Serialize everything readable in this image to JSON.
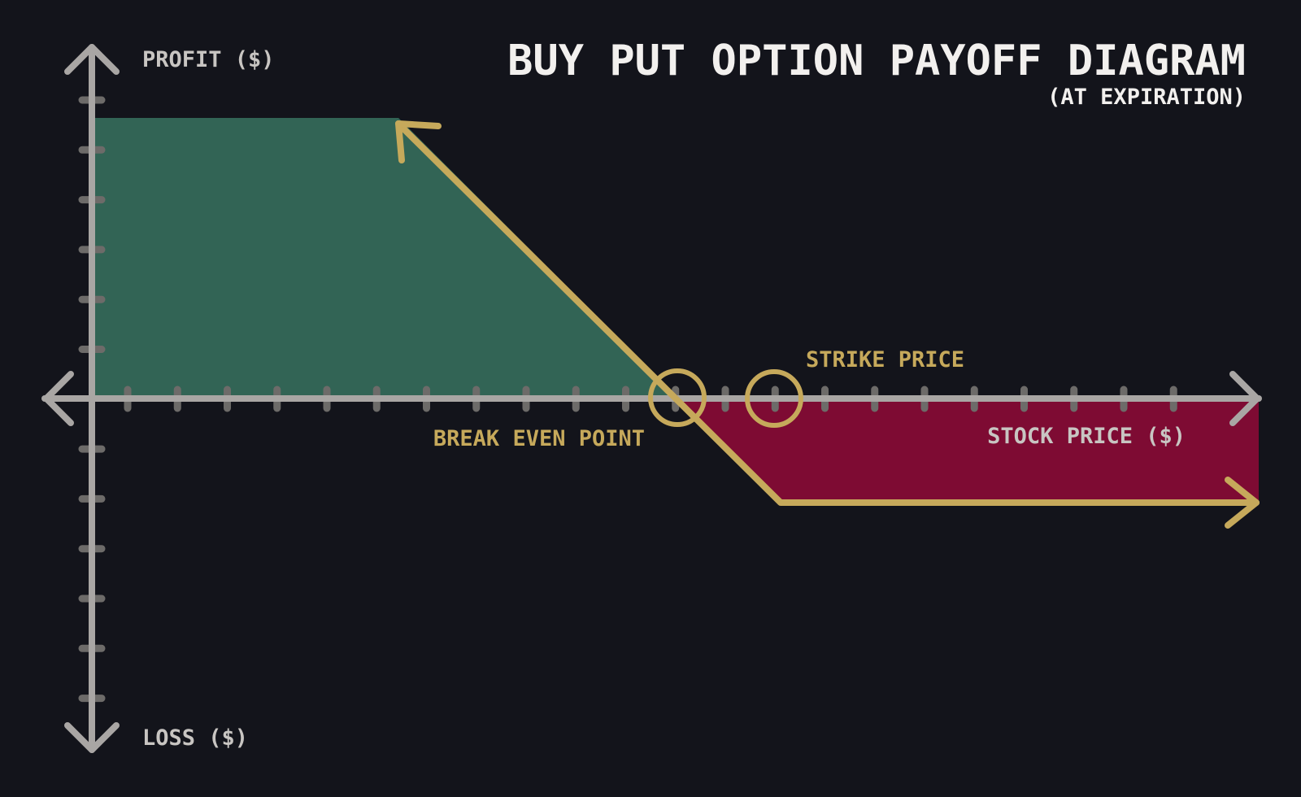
{
  "title": "BUY PUT OPTION PAYOFF DIAGRAM",
  "subtitle": "(AT EXPIRATION)",
  "axes": {
    "y_top_label": "PROFIT ($)",
    "y_bottom_label": "LOSS ($)",
    "x_label": "STOCK PRICE ($)"
  },
  "annotations": {
    "break_even": "BREAK EVEN POINT",
    "strike": "STRIKE PRICE"
  },
  "colors": {
    "background": "#13141b",
    "axis": "#a9a6a4",
    "tick": "#6d6b69",
    "payoff_line": "#c6a95b",
    "profit_fill": "#326455",
    "loss_fill": "#7e0b33",
    "title_text": "#f2f0ee",
    "axis_text": "#c8c5c2"
  }
}
